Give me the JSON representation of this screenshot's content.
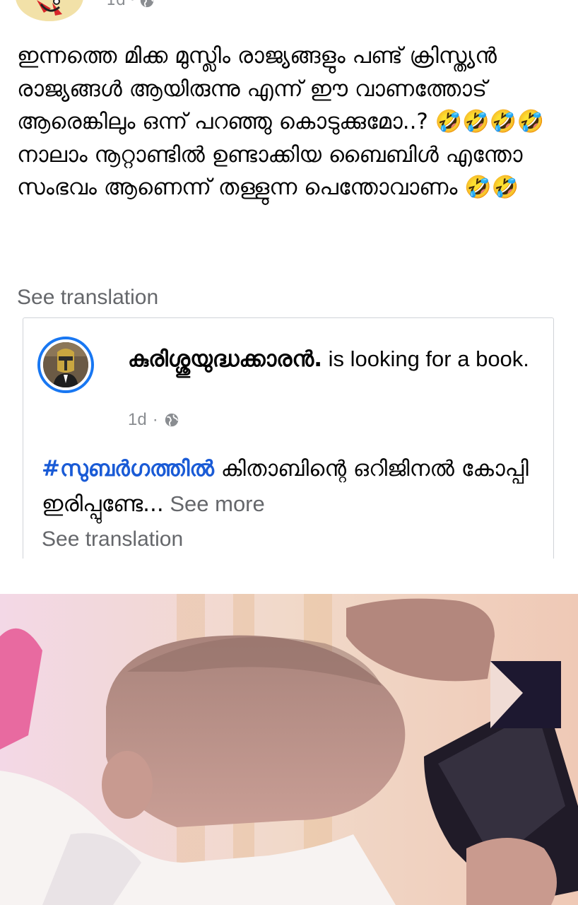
{
  "post": {
    "time": "1d",
    "text": "ഇന്നത്തെ മിക്ക മുസ്ലിം രാജ്യങ്ങളും പണ്ട് ക്രിസ്ത്യൻ രാജ്യങ്ങൾ ആയിരുന്നു എന്ന് ഈ വാണത്തോട് ആരെങ്കിലും ഒന്ന് പറഞ്ഞു കൊടുക്കുമോ..? 🤣🤣🤣🤣 നാലാം നൂറ്റാണ്ടിൽ ഉണ്ടാക്കിയ ബൈബിൾ എന്തോ സംഭവം ആണെന്ന് തള്ളുന്ന പെന്തോവാണം 🤣🤣",
    "see_translation": "See translation"
  },
  "shared": {
    "author_name": "കുരിശ്ശുയുദ്ധക്കാരൻ.",
    "status_text": " is looking for a book.",
    "time": "1d",
    "hashtag": "#സുബർഗത്തിൽ",
    "body_text": " കിതാബിന്റെ ഒറിജിനൽ കോപ്പി ഇരിപ്പുണ്ടേ...",
    "see_more": " See more",
    "see_translation": "See translation"
  },
  "icons": {
    "globe": "globe-icon",
    "avatar_top": "cartoon-avatar",
    "avatar_shared": "knight-helmet-avatar"
  },
  "colors": {
    "link_blue": "#1a5bd6",
    "avatar_ring": "#1877f2",
    "secondary_text": "#65676b",
    "meta_text": "#8a8d91"
  }
}
